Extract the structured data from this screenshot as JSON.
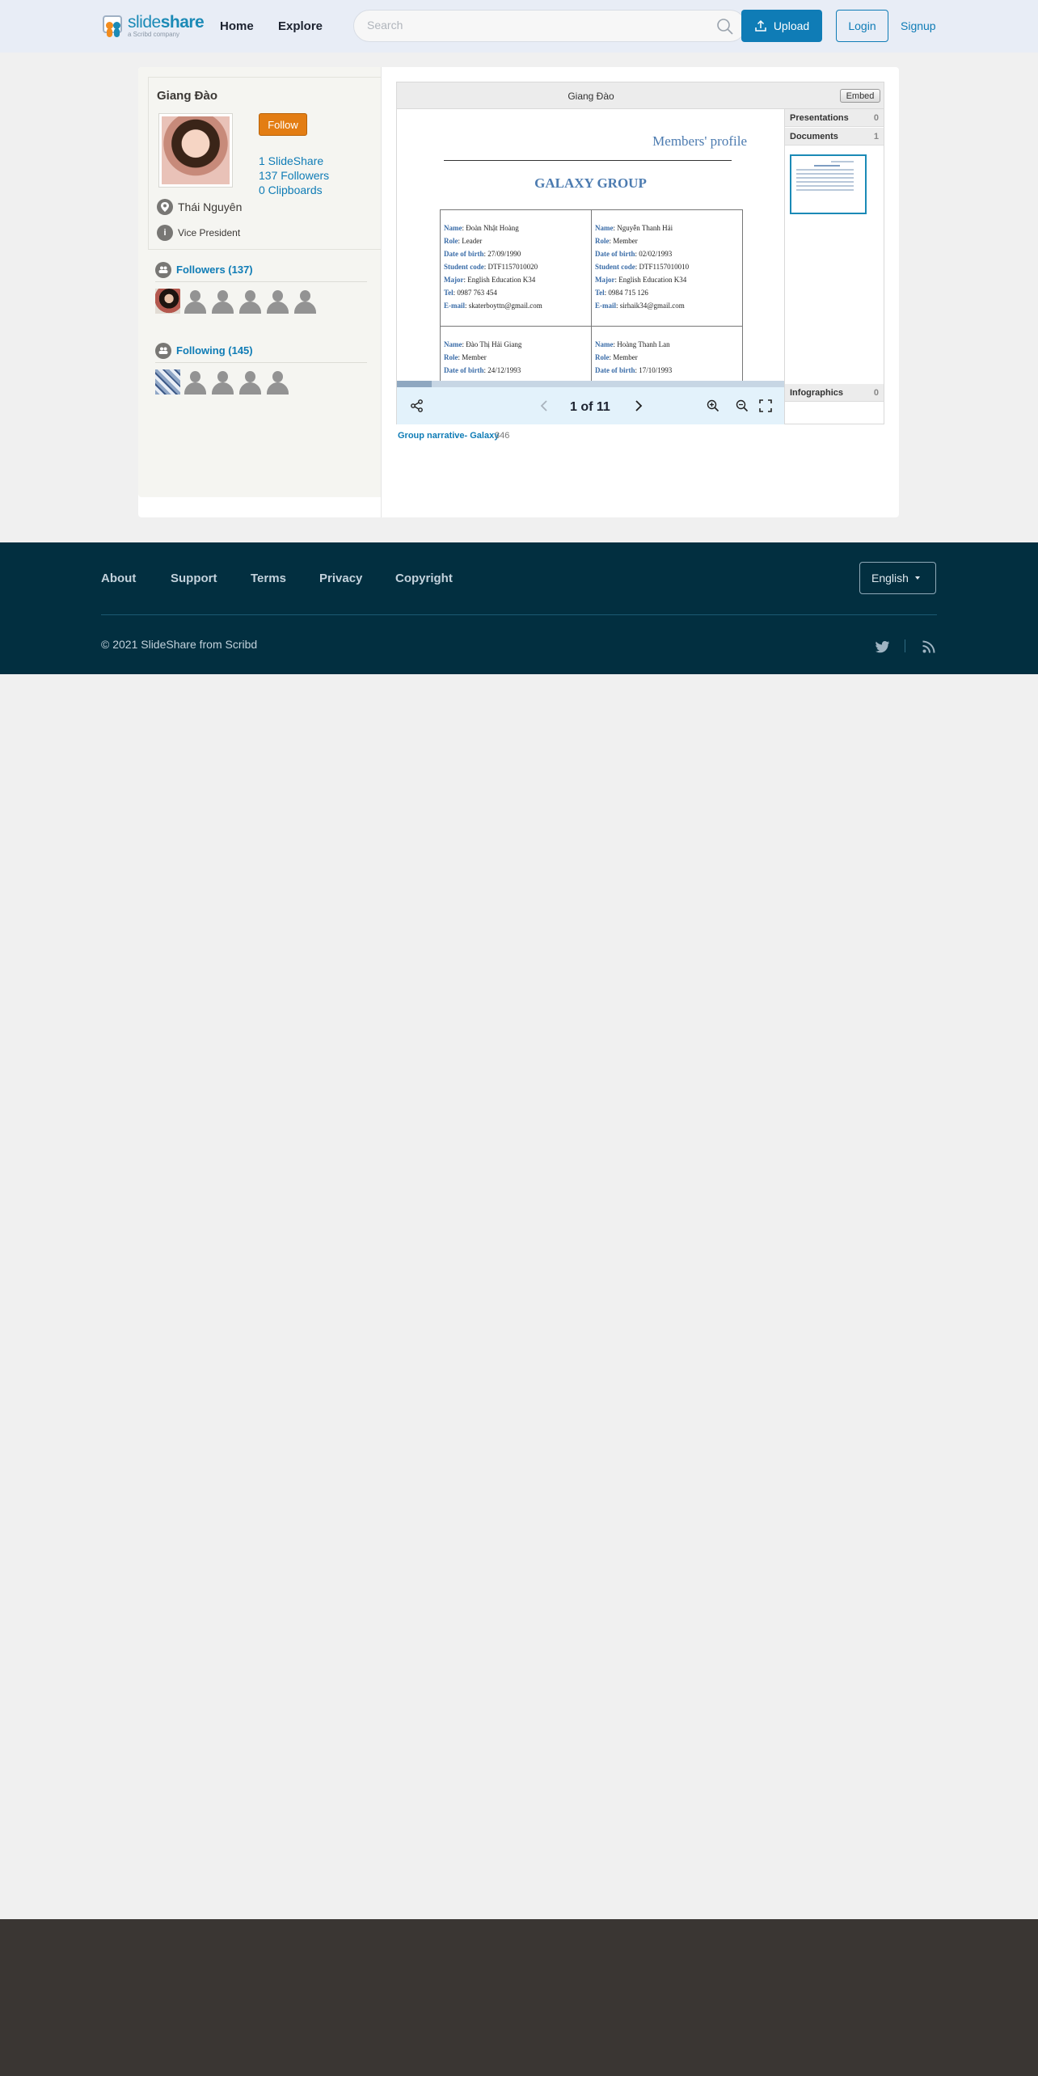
{
  "header": {
    "logo": {
      "brand_light": "slide",
      "brand_bold": "share",
      "tagline": "a Scribd company"
    },
    "nav": {
      "home": "Home",
      "explore": "Explore"
    },
    "search": {
      "placeholder": "Search"
    },
    "upload": "Upload",
    "login": "Login",
    "signup": "Signup"
  },
  "profile": {
    "name": "Giang Đào",
    "follow": "Follow",
    "stats": {
      "slideshare": "1 SlideShare",
      "followers": "137 Followers",
      "clipboards": "0 Clipboards"
    },
    "location": "Thái Nguyên",
    "job": "Vice President",
    "followers_section": {
      "label": "Followers (137)"
    },
    "following_section": {
      "label": "Following (145)"
    }
  },
  "player": {
    "title": "Giang Đào",
    "embed": "Embed",
    "page_counter": "1 of 11",
    "progress_fraction": 0.09,
    "slide": {
      "header": "Members' profile",
      "title": "GALAXY GROUP",
      "members": [
        [
          {
            "k": "Name",
            "v": ": Đoàn Nhật Hoàng"
          },
          {
            "k": "Role",
            "v": ": Leader"
          },
          {
            "k": "Date of birth",
            "v": ": 27/09/1990"
          },
          {
            "k": "Student code",
            "v": ": DTF1157010020"
          },
          {
            "k": "Major",
            "v": ": English Education K34"
          },
          {
            "k": "Tel",
            "v": ": 0987 763 454"
          },
          {
            "k": "E-mail",
            "v": ": skaterboyttn@gmail.com"
          }
        ],
        [
          {
            "k": "Name",
            "v": ": Nguyễn Thanh Hải"
          },
          {
            "k": "Role",
            "v": ": Member"
          },
          {
            "k": "Date of birth",
            "v": ": 02/02/1993"
          },
          {
            "k": "Student code",
            "v": ": DTF1157010010"
          },
          {
            "k": "Major",
            "v": ": English Education K34"
          },
          {
            "k": "Tel",
            "v": ": 0984 715 126"
          },
          {
            "k": "E-mail",
            "v": ": sirhaik34@gmail.com"
          }
        ],
        [
          {
            "k": "Name",
            "v": ": Đào Thị Hải Giang"
          },
          {
            "k": "Role",
            "v": ": Member"
          },
          {
            "k": "Date of birth",
            "v": ": 24/12/1993"
          }
        ],
        [
          {
            "k": "Name",
            "v": ": Hoàng Thanh Lan"
          },
          {
            "k": "Role",
            "v": ": Member"
          },
          {
            "k": "Date of birth",
            "v": ": 17/10/1993"
          }
        ]
      ]
    },
    "sidebar": {
      "presentations": {
        "label": "Presentations",
        "count": "0"
      },
      "documents": {
        "label": "Documents",
        "count": "1"
      },
      "infographics": {
        "label": "Infographics",
        "count": "0"
      }
    },
    "caption": {
      "title": "Group narrative- Galaxy",
      "views": "346"
    }
  },
  "footer": {
    "links": {
      "about": "About",
      "support": "Support",
      "terms": "Terms",
      "privacy": "Privacy",
      "copyright": "Copyright"
    },
    "language": "English",
    "copyright_text": "© 2021 SlideShare from Scribd"
  },
  "colors": {
    "accent": "#0f7cb6",
    "follow": "#e37d13",
    "footer_bg": "#022f40"
  }
}
